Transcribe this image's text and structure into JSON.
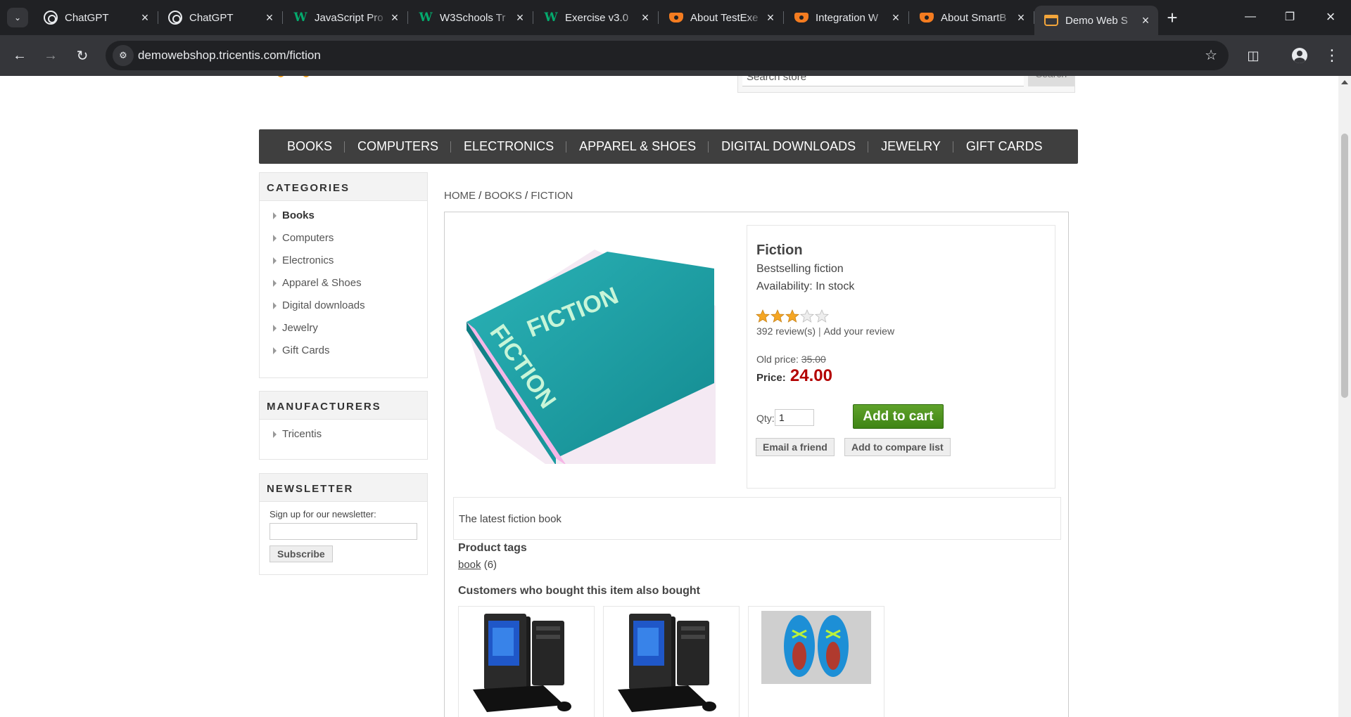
{
  "browser": {
    "tabs": [
      {
        "title": "ChatGPT",
        "icon": "chatgpt-icon"
      },
      {
        "title": "ChatGPT",
        "icon": "chatgpt-icon"
      },
      {
        "title": "JavaScript Pro",
        "icon": "w3schools-icon"
      },
      {
        "title": "W3Schools Tr",
        "icon": "w3schools-icon"
      },
      {
        "title": "Exercise v3.0",
        "icon": "w3schools-icon"
      },
      {
        "title": "About TestExe",
        "icon": "testexecute-icon"
      },
      {
        "title": "Integration W",
        "icon": "testexecute-icon"
      },
      {
        "title": "About SmartB",
        "icon": "testexecute-icon"
      },
      {
        "title": "Demo Web S",
        "icon": "cart-icon",
        "active": true
      }
    ],
    "url": "demowebshop.tricentis.com/fiction"
  },
  "header": {
    "search_placeholder": "Search store",
    "search_button": "Search"
  },
  "top_menu": [
    "BOOKS",
    "COMPUTERS",
    "ELECTRONICS",
    "APPAREL & SHOES",
    "DIGITAL DOWNLOADS",
    "JEWELRY",
    "GIFT CARDS"
  ],
  "sidebar": {
    "categories_title": "CATEGORIES",
    "categories": [
      "Books",
      "Computers",
      "Electronics",
      "Apparel & Shoes",
      "Digital downloads",
      "Jewelry",
      "Gift Cards"
    ],
    "manufacturers_title": "MANUFACTURERS",
    "manufacturers": [
      "Tricentis"
    ],
    "newsletter_title": "NEWSLETTER",
    "newsletter_label": "Sign up for our newsletter:",
    "subscribe_label": "Subscribe"
  },
  "breadcrumb": {
    "home": "HOME",
    "books": "BOOKS",
    "current": "FICTION",
    "separator": "/"
  },
  "product": {
    "name": "Fiction",
    "short_description": "Bestselling fiction",
    "availability": "Availability: In stock",
    "rating": 3,
    "rating_max": 5,
    "reviews": "392 review(s)",
    "review_sep": "|",
    "add_review": "Add your review",
    "old_price_label": "Old price:",
    "old_price": "35.00",
    "price_label": "Price:",
    "price": "24.00",
    "qty_label": "Qty:",
    "qty": "1",
    "add_to_cart": "Add to cart",
    "email_friend": "Email a friend",
    "compare": "Add to compare list",
    "cover_text": "FICTION",
    "full_description": "The latest fiction book",
    "tags_title": "Product tags",
    "tag": "book",
    "tag_count": "(6)",
    "also_bought_title": "Customers who bought this item also bought"
  },
  "colors": {
    "menu_bg": "#3f3f3f",
    "price": "#b30000",
    "cart_button": "#4a8f1c",
    "book_cover": "#1e9aa0"
  }
}
